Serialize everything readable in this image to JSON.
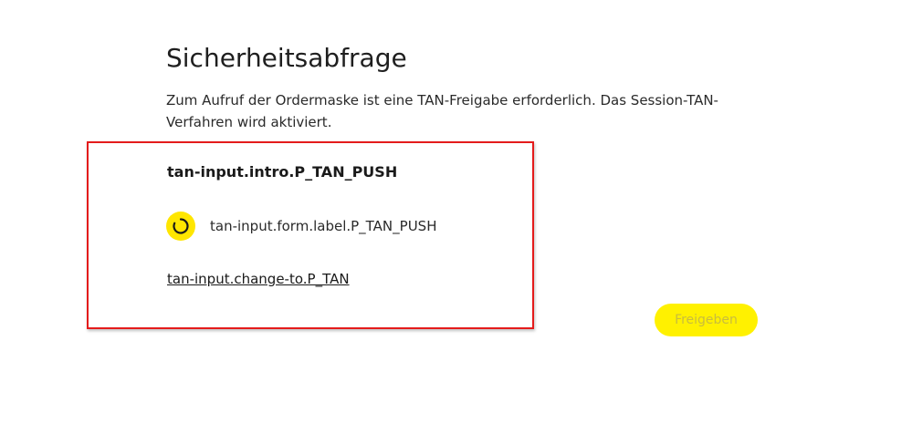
{
  "page": {
    "title": "Sicherheitsabfrage",
    "intro_text": "Zum Aufruf der Ordermaske ist eine TAN-Freigabe erforderlich. Das Session-TAN-Verfahren wird aktiviert."
  },
  "tan_box": {
    "heading": "tan-input.intro.P_TAN_PUSH",
    "spinner_icon": "loading-spinner-icon",
    "status_label": "tan-input.form.label.P_TAN_PUSH",
    "change_link": "tan-input.change-to.P_TAN",
    "highlight_color": "#e41b1b"
  },
  "actions": {
    "release_label": "Freigeben",
    "release_button_color": "#fff100"
  }
}
